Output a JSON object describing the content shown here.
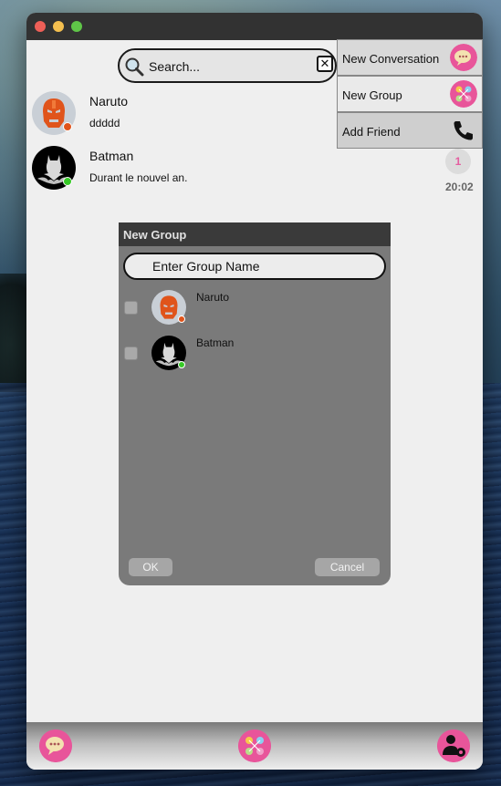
{
  "window": {
    "title": ""
  },
  "search": {
    "placeholder": "Search..."
  },
  "conversations": [
    {
      "name": "Naruto",
      "last_message": "ddddd",
      "status_color": "#e0541b",
      "unread": "",
      "time": ""
    },
    {
      "name": "Batman",
      "last_message": "Durant le nouvel an.",
      "status_color": "#36c926",
      "unread": "1",
      "time": "20:02"
    }
  ],
  "menu": {
    "items": [
      {
        "label": "New Conversation",
        "icon": "chat-bubble-icon"
      },
      {
        "label": "New Group",
        "icon": "group-icon"
      },
      {
        "label": "Add Friend",
        "icon": "phone-icon"
      }
    ]
  },
  "dialog": {
    "title": "New Group",
    "group_name_placeholder": "Enter Group Name",
    "members": [
      {
        "name": "Naruto",
        "checked": false,
        "status_color": "#e0541b"
      },
      {
        "name": "Batman",
        "checked": false,
        "status_color": "#36c926"
      }
    ],
    "ok_label": "OK",
    "cancel_label": "Cancel"
  },
  "bottombar": {
    "items": [
      {
        "icon": "chat-bubble-icon"
      },
      {
        "icon": "group-icon"
      },
      {
        "icon": "profile-settings-icon"
      }
    ]
  },
  "colors": {
    "accent_pink": "#e8559a",
    "online": "#36c926",
    "away": "#e0541b"
  }
}
